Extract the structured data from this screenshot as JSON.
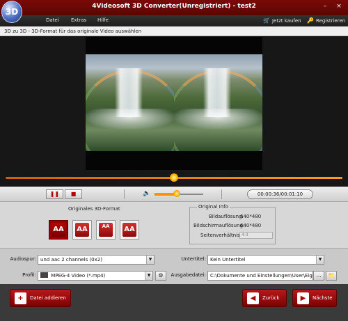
{
  "window": {
    "title": "4Videosoft 3D Converter(Unregistriert) - test2",
    "logo_text": "3D",
    "minimize": "–",
    "close": "×"
  },
  "menu": {
    "items": [
      "Datei",
      "Extras",
      "Hilfe"
    ],
    "buy": "Jetzt kaufen",
    "register": "Registrieren"
  },
  "hint": "3D zu 3D - 3D-Format für das originale Video auswählen",
  "player": {
    "progress": 0.5,
    "volume": 0.45,
    "time": "00:00:36/00:01:10",
    "pause_icon": "pause-icon",
    "stop_icon": "stop-icon",
    "volume_icon": "speaker-icon"
  },
  "format": {
    "label": "Originales 3D-Format",
    "buttons": [
      "AA",
      "AA",
      "AA",
      "AA"
    ],
    "selected_index": 0
  },
  "original_info": {
    "legend": "Original Info",
    "resolution_label": "Bildauflösung:",
    "resolution_value": "640*480",
    "screen_label": "Bildschirmauflösung:",
    "screen_value": "640*480",
    "ratio_label": "Seitenverhältnis:",
    "ratio_value": "4:3"
  },
  "fields": {
    "audio_label": "Audiospur:",
    "audio_value": "und aac 2 channels (0x2)",
    "subtitle_label": "Untertitel:",
    "subtitle_value": "Kein Untertitel",
    "profile_label": "Profil:",
    "profile_value": "MPEG-4 Video (*.mp4)",
    "output_label": "Ausgabedatei:",
    "output_value": "C:\\Dokumente und Einstellungen\\User\\Eigene Da",
    "browse": "..."
  },
  "buttons": {
    "add_file": "Datei addieren",
    "back": "Zurück",
    "next": "Nächste"
  },
  "colors": {
    "accent": "#a00000",
    "progress": "#ff9b20"
  }
}
